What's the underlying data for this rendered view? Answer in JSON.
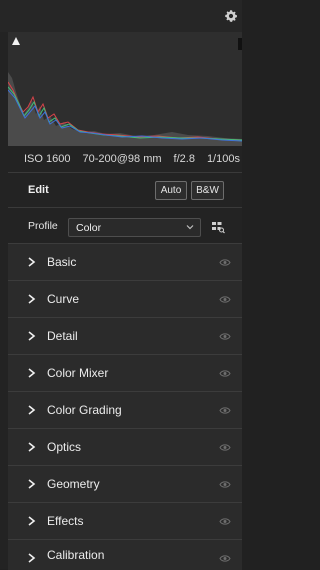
{
  "exif": {
    "iso": "ISO 1600",
    "lens": "70-200@98 mm",
    "aperture": "f/2.8",
    "shutter": "1/100s"
  },
  "edit": {
    "title": "Edit",
    "auto_label": "Auto",
    "bw_label": "B&W"
  },
  "profile": {
    "label": "Profile",
    "value": "Color"
  },
  "sections": [
    {
      "label": "Basic"
    },
    {
      "label": "Curve"
    },
    {
      "label": "Detail"
    },
    {
      "label": "Color Mixer"
    },
    {
      "label": "Color Grading"
    },
    {
      "label": "Optics"
    },
    {
      "label": "Geometry"
    },
    {
      "label": "Effects"
    },
    {
      "label": "Calibration"
    }
  ],
  "icons": {
    "gear": "gear-icon",
    "clip_shadow": "shadow-clipping-icon",
    "profile_browser": "profile-browser-icon",
    "section_chevron": "chevron-right-icon",
    "visibility": "eye-icon"
  },
  "colors": {
    "panel_bg": "#232323",
    "section_bg": "#2b2b2b",
    "histogram_bg": "#2e2e2e",
    "hist_red": "#d9434a",
    "hist_green": "#3fbf7a",
    "hist_blue": "#3f73d9"
  }
}
